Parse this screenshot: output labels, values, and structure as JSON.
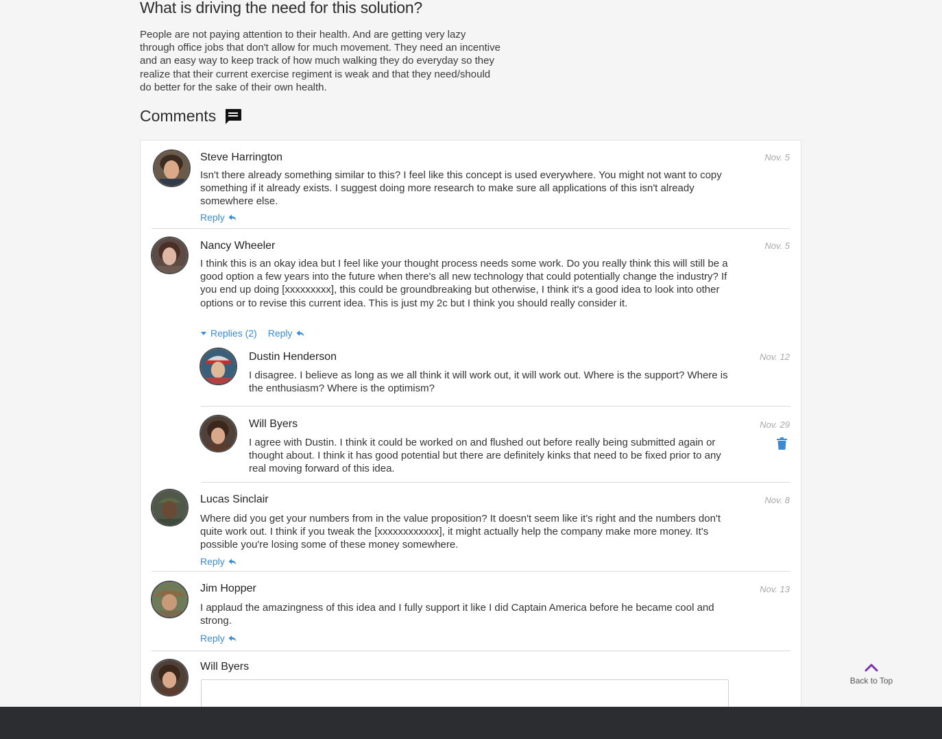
{
  "problem": {
    "heading": "What is driving the need for this solution?",
    "text": "People are not paying attention to their health. And are getting very lazy through office jobs that don't allow for much movement. They need an incentive and an easy way to keep track of how much walking they do everyday so they realize that their current exercise regiment is weak and that they need/should do better for the sake of their own health."
  },
  "comments_section": {
    "title": "Comments",
    "icon": "comment-icon"
  },
  "comments": [
    {
      "author": "Steve Harrington",
      "date": "Nov. 5",
      "text": "Isn't there already something similar to this? I feel like this concept is used everywhere. You might not want to copy something if it already exists. I suggest doing more research to make sure all applications of this isn't already somewhere else.",
      "reply_label": "Reply"
    },
    {
      "author": "Nancy Wheeler",
      "date": "Nov. 5",
      "text": "I think this is an okay idea but I feel like your thought process needs some work. Do you really think this will still be a good option a few years into the future when there's all new technology that could potentially change the industry? If you end up doing [xxxxxxxxx], this could be groundbreaking but otherwise, I think it's a good idea to look into other options or to revise this current idea. This is just my 2c but I think you should really consider it.",
      "replies_toggle_label": "Replies (2)",
      "reply_label": "Reply",
      "replies": [
        {
          "author": "Dustin Henderson",
          "date": "Nov. 12",
          "text": "I disagree. I believe as long as we all think it will work out, it will work out. Where is the support? Where is the enthusiasm? Where is the optimism?"
        },
        {
          "author": "Will Byers",
          "date": "Nov. 29",
          "text": "I agree with Dustin. I think it could be worked on and flushed out before really being submitted again or thought about. I think it has good potential but there are definitely kinks that need to be fixed prior to any real moving forward of this idea.",
          "delete_icon": "trash-icon"
        }
      ]
    },
    {
      "author": "Lucas Sinclair",
      "date": "Nov. 8",
      "text": "Where did you get your numbers from in the value proposition? It doesn't seem like it's right and the numbers don't quite work out. I think if you tweak the [xxxxxxxxxxxx], it might actually help the company make more money. It's possible you're losing some of these money somewhere.",
      "reply_label": "Reply"
    },
    {
      "author": "Jim Hopper",
      "date": "Nov. 13",
      "text": "I applaud the amazingness of this idea and I fully support it like I did Captain America before he became cool and strong.",
      "reply_label": "Reply"
    }
  ],
  "new_comment": {
    "author": "Will Byers",
    "value": ""
  },
  "back_to_top": {
    "label": "Back to Top",
    "icon": "chevron-up-icon"
  },
  "colors": {
    "link": "#3a8bd4",
    "accent_purple": "#7b2fb5",
    "footer": "#2c2d30"
  }
}
